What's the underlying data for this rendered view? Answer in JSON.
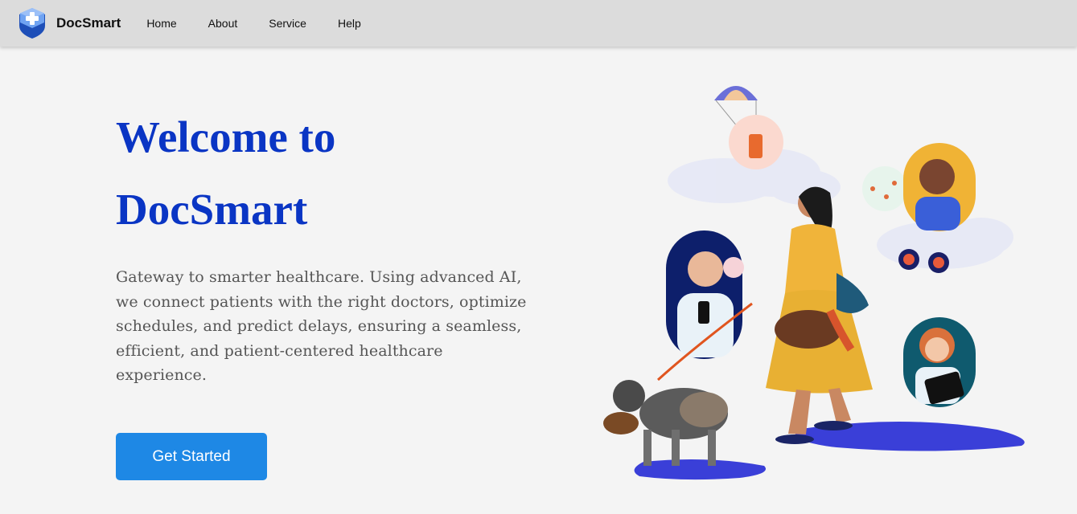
{
  "brand": {
    "name": "DocSmart",
    "logo_icon": "shield-plus-icon",
    "logo_color": "#4f8ef7"
  },
  "nav": {
    "items": [
      {
        "label": "Home"
      },
      {
        "label": "About"
      },
      {
        "label": "Service"
      },
      {
        "label": "Help"
      }
    ]
  },
  "hero": {
    "title_line1": "Welcome to",
    "title_line2": "DocSmart",
    "description": "Gateway to smarter healthcare. Using advanced AI, we connect patients with the right doctors, optimize schedules, and predict delays, ensuring a seamless, efficient, and patient-centered healthcare experience.",
    "cta_label": "Get Started"
  },
  "colors": {
    "title": "#0a35c4",
    "button": "#1e88e5",
    "navbar": "#dcdcdc",
    "background": "#f4f4f4"
  }
}
